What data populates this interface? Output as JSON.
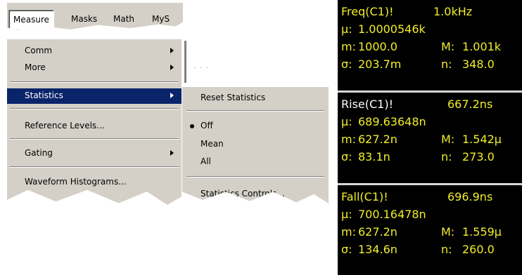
{
  "menubar": {
    "items": [
      "Measure",
      "Masks",
      "Math",
      "MyS"
    ]
  },
  "measure_menu": {
    "items": [
      {
        "label": "Comm",
        "submenu": true
      },
      {
        "label": "More",
        "submenu": true
      },
      {
        "label": "Statistics",
        "submenu": true,
        "highlighted": true
      },
      {
        "label": "Reference Levels...",
        "submenu": false
      },
      {
        "label": "Gating",
        "submenu": true
      },
      {
        "label": "Waveform Histograms...",
        "submenu": false
      }
    ]
  },
  "statistics_submenu": {
    "reset": "Reset Statistics",
    "options": [
      "Off",
      "Mean",
      "All"
    ],
    "selected": "Off",
    "controls": "Statistics Controls..."
  },
  "readouts": [
    {
      "title": "Freq(C1)!",
      "value": "1.0kHz",
      "mu_label": "μ:",
      "mu": "1.0000546k",
      "m_label": "m:",
      "m": "1000.0",
      "M_label": "M:",
      "M": "1.001k",
      "sigma_label": "σ:",
      "sigma": "203.7m",
      "n_label": "n:",
      "n": "348.0"
    },
    {
      "title": "Rise(C1)!",
      "value": "667.2ns",
      "mu_label": "μ:",
      "mu": "689.63648n",
      "m_label": "m:",
      "m": "627.2n",
      "M_label": "M:",
      "M": "1.542μ",
      "sigma_label": "σ:",
      "sigma": "83.1n",
      "n_label": "n:",
      "n": "273.0"
    },
    {
      "title": "Fall(C1)!",
      "value": "696.9ns",
      "mu_label": "μ:",
      "mu": "700.16478n",
      "m_label": "m:",
      "m": "627.2n",
      "M_label": "M:",
      "M": "1.559μ",
      "sigma_label": "σ:",
      "sigma": "134.6n",
      "n_label": "n:",
      "n": "260.0"
    }
  ],
  "colors": {
    "menu_bg": "#d4d0c8",
    "highlight": "#0a246a",
    "readout_title": "#f2ee2a",
    "readout_text": "#ffffff",
    "panel_bg": "#000000"
  }
}
